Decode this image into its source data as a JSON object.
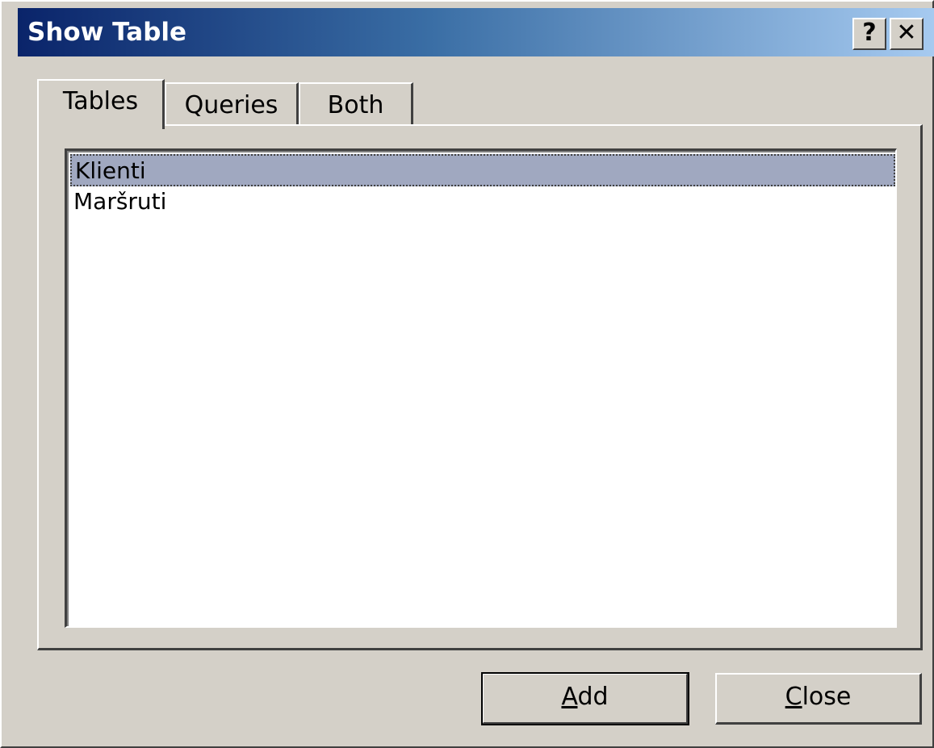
{
  "window": {
    "title": "Show Table",
    "help_label": "?",
    "close_label": "✕"
  },
  "tabs": [
    {
      "label": "Tables",
      "active": true
    },
    {
      "label": "Queries",
      "active": false
    },
    {
      "label": "Both",
      "active": false
    }
  ],
  "list": {
    "items": [
      {
        "label": "Klienti",
        "selected": true
      },
      {
        "label": "Maršruti",
        "selected": false
      }
    ]
  },
  "buttons": {
    "add_accel": "A",
    "add_rest": "dd",
    "close_accel": "C",
    "close_rest": "lose"
  },
  "colors": {
    "title_start": "#0a246a",
    "title_end": "#a6caf0",
    "selection": "#a0a8c0",
    "face": "#d4d0c8"
  }
}
